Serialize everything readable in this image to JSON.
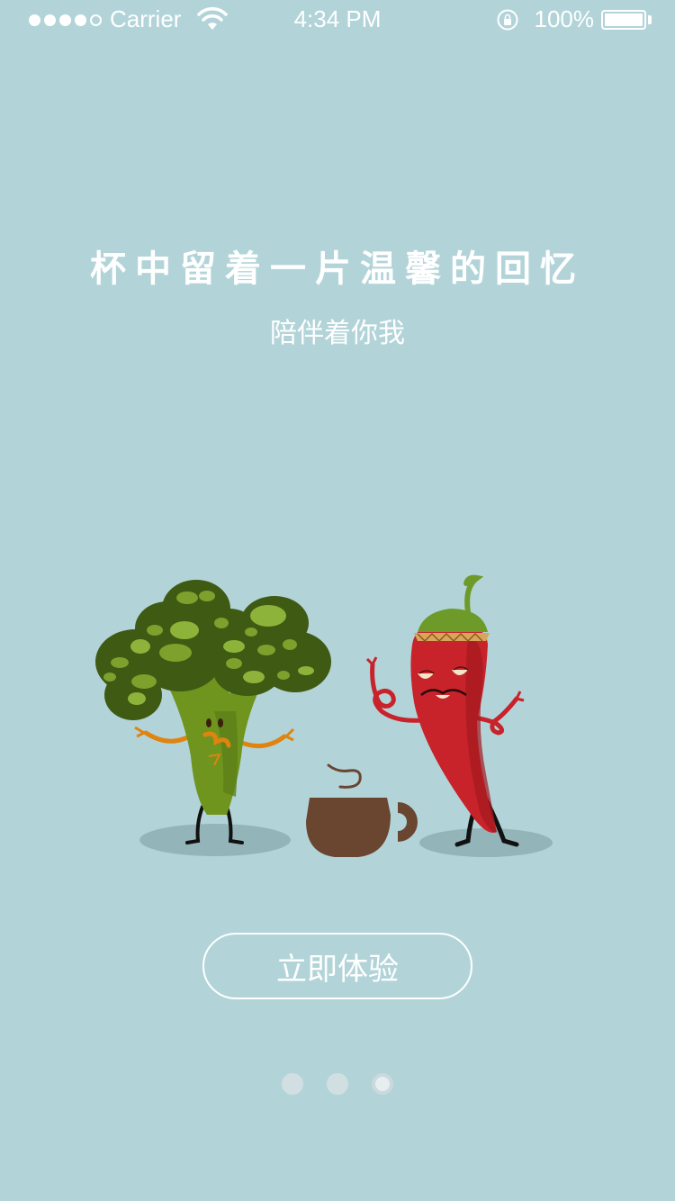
{
  "status_bar": {
    "carrier": "Carrier",
    "time": "4:34 PM",
    "battery": "100%",
    "signal_bars": 4
  },
  "onboarding": {
    "title": "杯中留着一片温馨的回忆",
    "subtitle": "陪伴着你我",
    "cta_label": "立即体验",
    "page_count": 3,
    "active_page": 3
  },
  "illustration": {
    "characters": [
      "broccoli",
      "coffee-cup",
      "chili-pepper"
    ]
  },
  "colors": {
    "background": "#b2d4d9",
    "text": "#ffffff",
    "broccoli_dark": "#3f5a12",
    "broccoli_light": "#8db33a",
    "chili": "#c8232a",
    "cup": "#6a4631"
  }
}
